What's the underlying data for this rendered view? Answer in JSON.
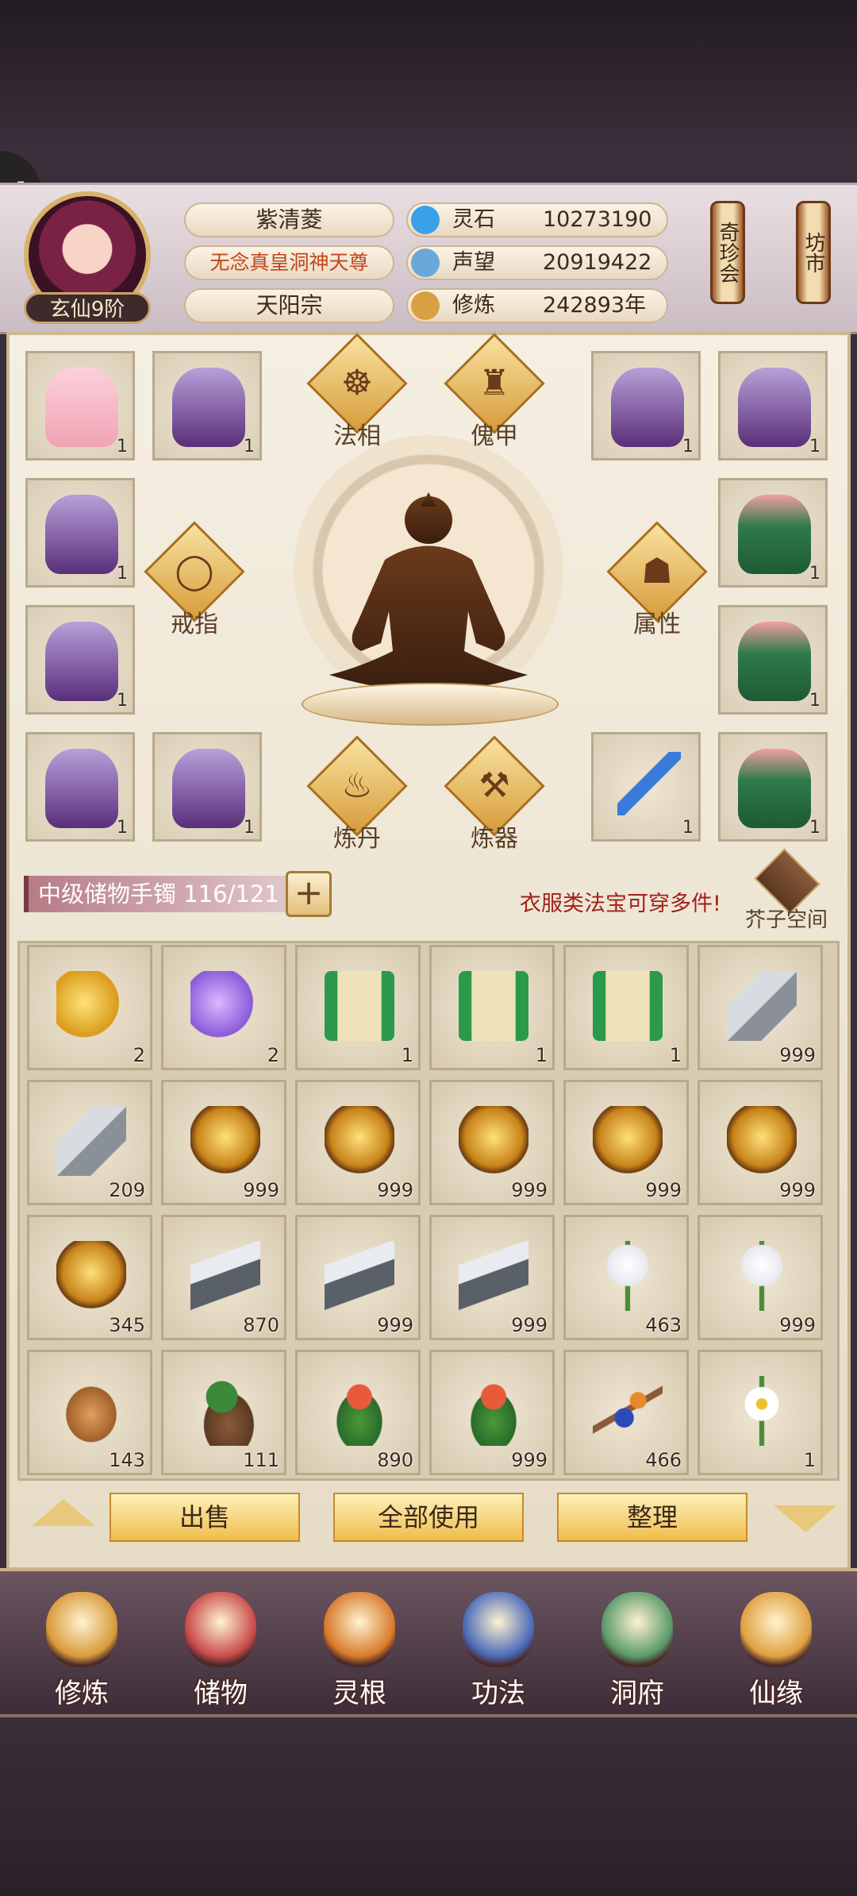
{
  "player": {
    "name": "紫清菱",
    "title": "无念真皇洞神天尊",
    "sect": "天阳宗",
    "rank": "玄仙9阶"
  },
  "resources": [
    {
      "label": "灵石",
      "value": "10273190",
      "icon": "spirit-stone-icon",
      "color": "#3aa0e8"
    },
    {
      "label": "声望",
      "value": "20919422",
      "icon": "reputation-icon",
      "color": "#6aa8d8"
    },
    {
      "label": "修炼",
      "value": "242893年",
      "icon": "cultivation-icon",
      "color": "#d8a040"
    }
  ],
  "side_buttons": [
    {
      "label": "奇珍会"
    },
    {
      "label": "坊市"
    }
  ],
  "equip_labels": {
    "faxiang": "法相",
    "kuijia": "傀甲",
    "jiezhi": "戒指",
    "shuxing": "属性",
    "liandan": "炼丹",
    "lianqi": "炼器"
  },
  "equip_left": [
    {
      "count": "1",
      "kind": "pink-robe"
    },
    {
      "count": "1",
      "kind": "purple-robe"
    },
    {
      "count": "1",
      "kind": "purple-robe"
    },
    {
      "count": "1",
      "kind": "purple-robe"
    },
    {
      "count": "1",
      "kind": "purple-robe"
    },
    {
      "count": "1",
      "kind": "purple-robe"
    }
  ],
  "equip_right": [
    {
      "count": "1",
      "kind": "purple-robe"
    },
    {
      "count": "1",
      "kind": "purple-robe"
    },
    {
      "count": "1",
      "kind": "green-robe"
    },
    {
      "count": "1",
      "kind": "green-robe"
    },
    {
      "count": "1",
      "kind": "blade"
    },
    {
      "count": "1",
      "kind": "green-robe"
    }
  ],
  "storage": {
    "label": "中级储物手镯 116/121",
    "notice": "衣服类法宝可穿多件!",
    "space": "芥子空间"
  },
  "inventory": [
    {
      "count": "2",
      "kind": "gold-cloud"
    },
    {
      "count": "2",
      "kind": "purple-cloud"
    },
    {
      "count": "1",
      "kind": "scroll"
    },
    {
      "count": "1",
      "kind": "scroll"
    },
    {
      "count": "1",
      "kind": "scroll"
    },
    {
      "count": "999",
      "kind": "silver-stone"
    },
    {
      "count": "209",
      "kind": "silver-stone"
    },
    {
      "count": "999",
      "kind": "gold-ore"
    },
    {
      "count": "999",
      "kind": "gold-ore"
    },
    {
      "count": "999",
      "kind": "gold-ore"
    },
    {
      "count": "999",
      "kind": "gold-ore"
    },
    {
      "count": "999",
      "kind": "gold-ore"
    },
    {
      "count": "345",
      "kind": "gold-ore"
    },
    {
      "count": "870",
      "kind": "iron-ingot"
    },
    {
      "count": "999",
      "kind": "iron-ingot"
    },
    {
      "count": "999",
      "kind": "iron-ingot"
    },
    {
      "count": "463",
      "kind": "white-lily"
    },
    {
      "count": "999",
      "kind": "white-lily"
    },
    {
      "count": "143",
      "kind": "ginseng"
    },
    {
      "count": "111",
      "kind": "root-herb"
    },
    {
      "count": "890",
      "kind": "red-herb"
    },
    {
      "count": "999",
      "kind": "red-herb"
    },
    {
      "count": "466",
      "kind": "fruit-branch"
    },
    {
      "count": "1",
      "kind": "daisy"
    }
  ],
  "actions": {
    "sell": "出售",
    "use_all": "全部使用",
    "sort": "整理"
  },
  "nav": [
    {
      "label": "修炼",
      "icon": "cultivate-icon",
      "color": "#d99a3a"
    },
    {
      "label": "储物",
      "icon": "storage-bag-icon",
      "color": "#c94a4a"
    },
    {
      "label": "灵根",
      "icon": "spirit-root-icon",
      "color": "#d87a2a"
    },
    {
      "label": "功法",
      "icon": "technique-book-icon",
      "color": "#4a6ab8"
    },
    {
      "label": "洞府",
      "icon": "cave-dwelling-icon",
      "color": "#5a9a6a"
    },
    {
      "label": "仙缘",
      "icon": "immortal-fate-icon",
      "color": "#e0a040"
    }
  ]
}
